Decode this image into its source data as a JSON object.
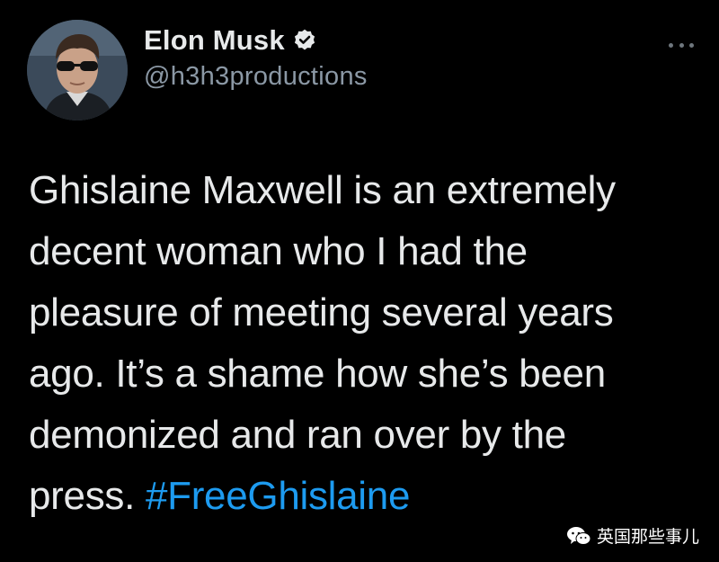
{
  "tweet": {
    "author": {
      "display_name": "Elon Musk",
      "handle": "@h3h3productions",
      "verified": true,
      "avatar": "profile-photo"
    },
    "text_segments": [
      "Ghislaine Maxwell is an extremely",
      "decent woman who I had the",
      "pleasure of meeting several years",
      "ago. It’s a shame how she’s been",
      "demonized and ran over by the",
      "press. "
    ],
    "hashtag": "#FreeGhislaine",
    "more_icon": "more-horizontal-icon"
  },
  "watermark": {
    "icon": "wechat-icon",
    "text": "英国那些事儿"
  },
  "colors": {
    "background": "#000000",
    "text": "#e7e9ea",
    "handle": "#8b98a5",
    "hashtag": "#1d9bf0"
  }
}
